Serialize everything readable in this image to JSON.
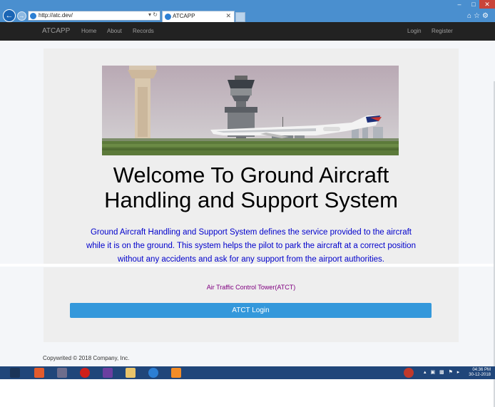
{
  "browser": {
    "url": "http://atc.dev/",
    "tab_title": "ATCAPP"
  },
  "navbar": {
    "brand": "ATCAPP",
    "links": [
      "Home",
      "About",
      "Records"
    ],
    "right_links": [
      "Login",
      "Register"
    ]
  },
  "jumbotron": {
    "headline_line1": "Welcome To Ground Aircraft",
    "headline_line2": "Handling and Support System",
    "lead_line1": "Ground Aircraft Handling and Support System defines the service provided to the aircraft",
    "lead_line2": "while it is on the ground. This system helps the pilot to park the aircraft at a correct position",
    "lead_line3": "without any accidents and ask for any support from the airport authorities."
  },
  "atct": {
    "title": "Air Traffic Control Tower(ATCT)",
    "button": "ATCT Login"
  },
  "footer": "Copywrited © 2018 Company, Inc.",
  "taskbar": {
    "time": "04:36 PM",
    "date": "30-12-2018"
  },
  "colors": {
    "navbar": "#222222",
    "lead_text": "#0000cc",
    "atct_title": "#800080",
    "button": "#3498db",
    "ie_chrome": "#4a8fcf",
    "taskbar": "#20467a"
  }
}
